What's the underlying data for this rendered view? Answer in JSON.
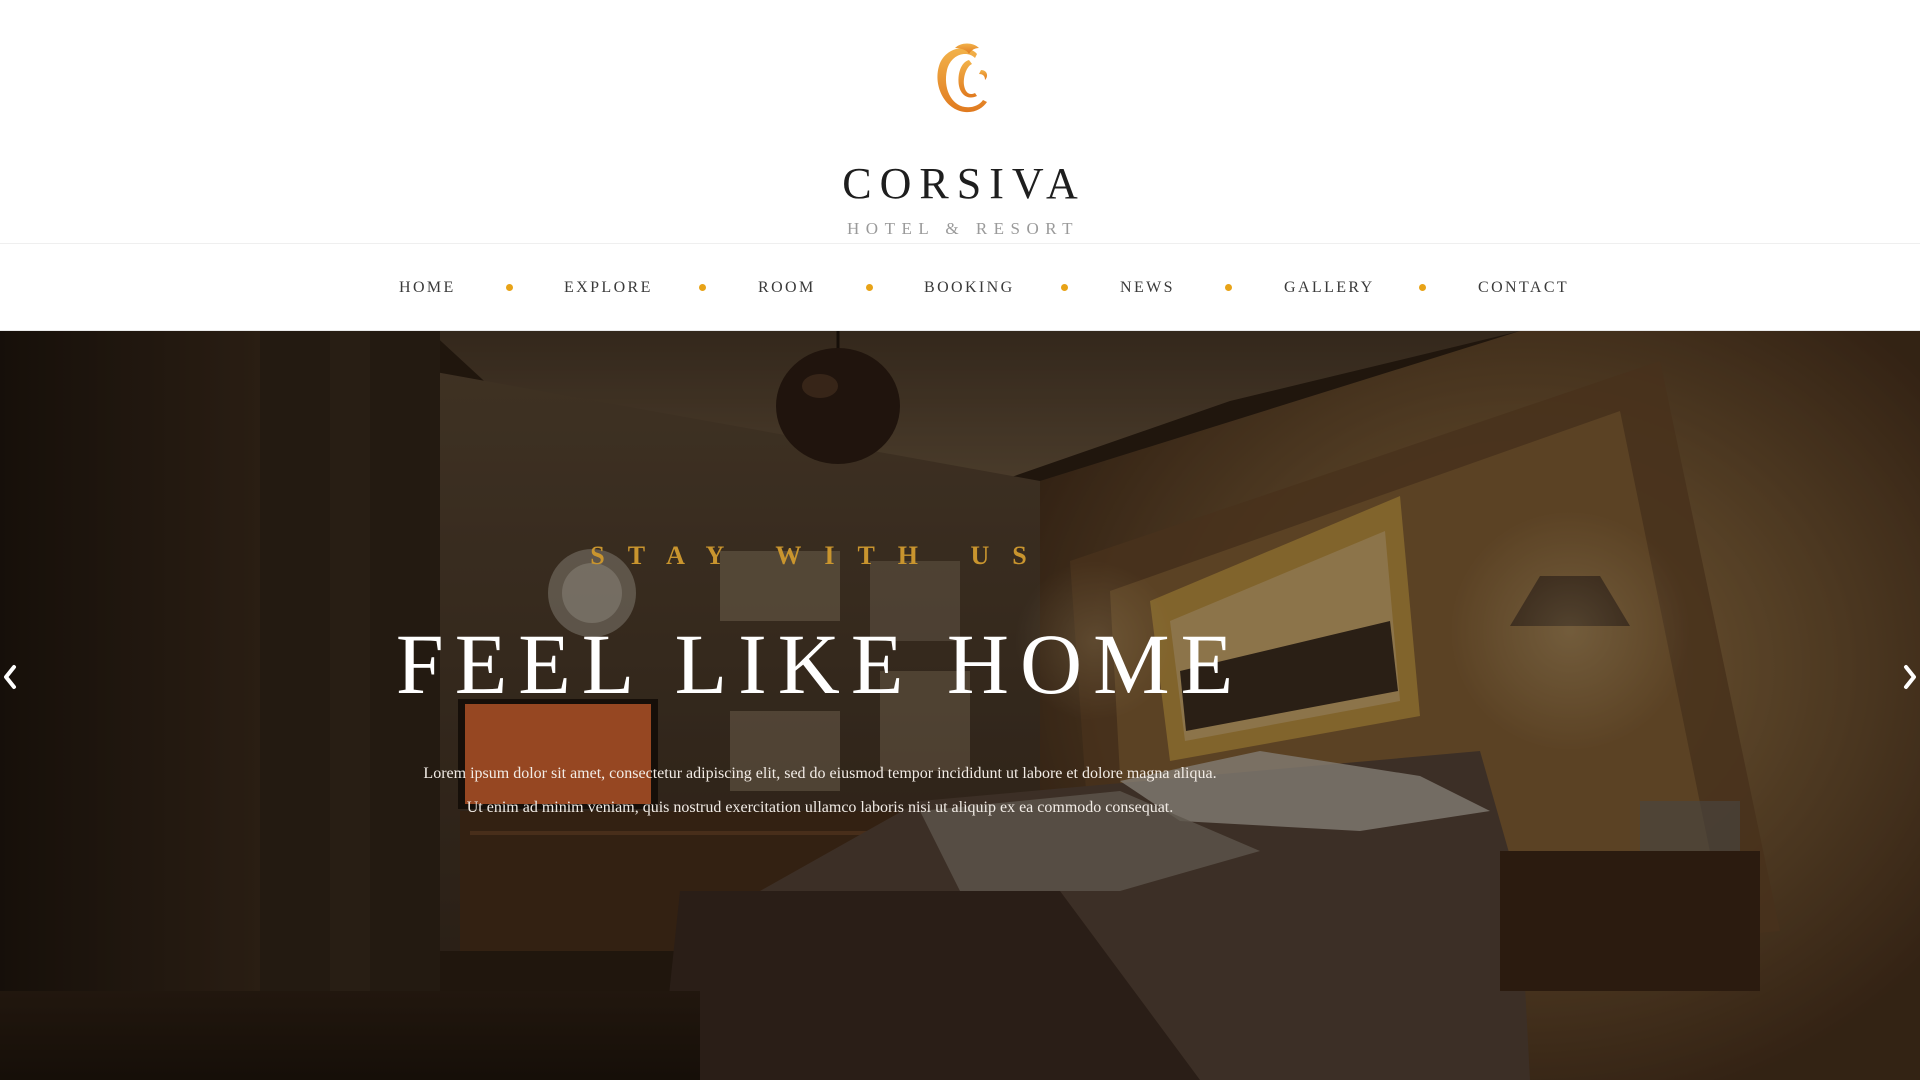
{
  "brand": {
    "name": "CORSIVA",
    "subtitle": "HOTEL & RESORT",
    "logo_icon": "ornate-letter-c-logo",
    "accent_color": "#e8a317"
  },
  "nav": {
    "items": [
      {
        "label": "HOME"
      },
      {
        "label": "EXPLORE"
      },
      {
        "label": "ROOM"
      },
      {
        "label": "BOOKING"
      },
      {
        "label": "NEWS"
      },
      {
        "label": "GALLERY"
      },
      {
        "label": "CONTACT"
      }
    ],
    "separator_color": "#e8a317"
  },
  "hero": {
    "eyebrow": "STAY WITH US",
    "title": "FEEL LIKE HOME",
    "description": "Lorem ipsum dolor sit amet, consectetur adipiscing elit, sed do eiusmod tempor incididunt ut labore et dolore magna aliqua. Ut enim ad minim veniam, quis nostrud exercitation ullamco laboris nisi ut aliquip ex ea commodo consequat.",
    "eyebrow_color": "#c9952e",
    "prev_icon": "chevron-left-icon",
    "next_icon": "chevron-right-icon"
  }
}
